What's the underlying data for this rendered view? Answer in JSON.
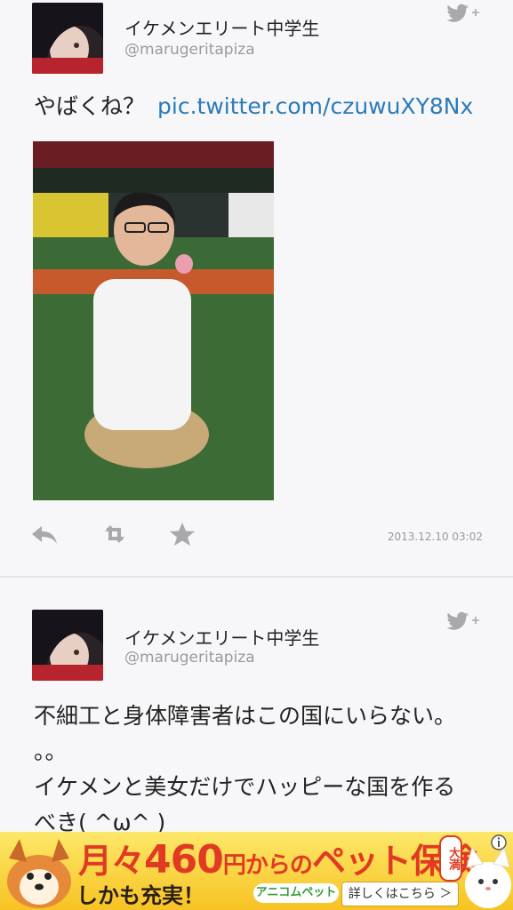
{
  "tweets": [
    {
      "display_name": "イケメンエリート中学生",
      "handle": "@marugeritapiza",
      "text": "やばくね？",
      "link": "pic.twitter.com/czuwuXY8Nx",
      "timestamp": "2013.12.10 03:02",
      "avatar_icon": "user-avatar",
      "follow_icon": "twitter-bird-plus-icon",
      "actions": [
        "reply-icon",
        "retweet-icon",
        "favorite-star-icon"
      ]
    },
    {
      "display_name": "イケメンエリート中学生",
      "handle": "@marugeritapiza",
      "text_lines": [
        "不細工と身体障害者はこの国にいらない。",
        "。。",
        "イケメンと美女だけでハッピーな国を作る",
        "べき( ^ω^ )"
      ],
      "follow_icon": "twitter-bird-plus-icon"
    }
  ],
  "ad": {
    "headline_pre": "月々",
    "headline_amount": "460",
    "headline_mid": "円からの",
    "headline_product": "ペット保険",
    "badge": "大満",
    "subline": "しかも充実！",
    "brand": "アニコムペット",
    "cta": "詳しくはこちら ＞",
    "info_icon": "ad-info-icon"
  },
  "colors": {
    "link": "#2b7bb9",
    "muted": "#9a9a9a",
    "icon_gray": "#a8a8ad",
    "ad_red": "#e13a23",
    "ad_yellow": "#f7c323"
  }
}
